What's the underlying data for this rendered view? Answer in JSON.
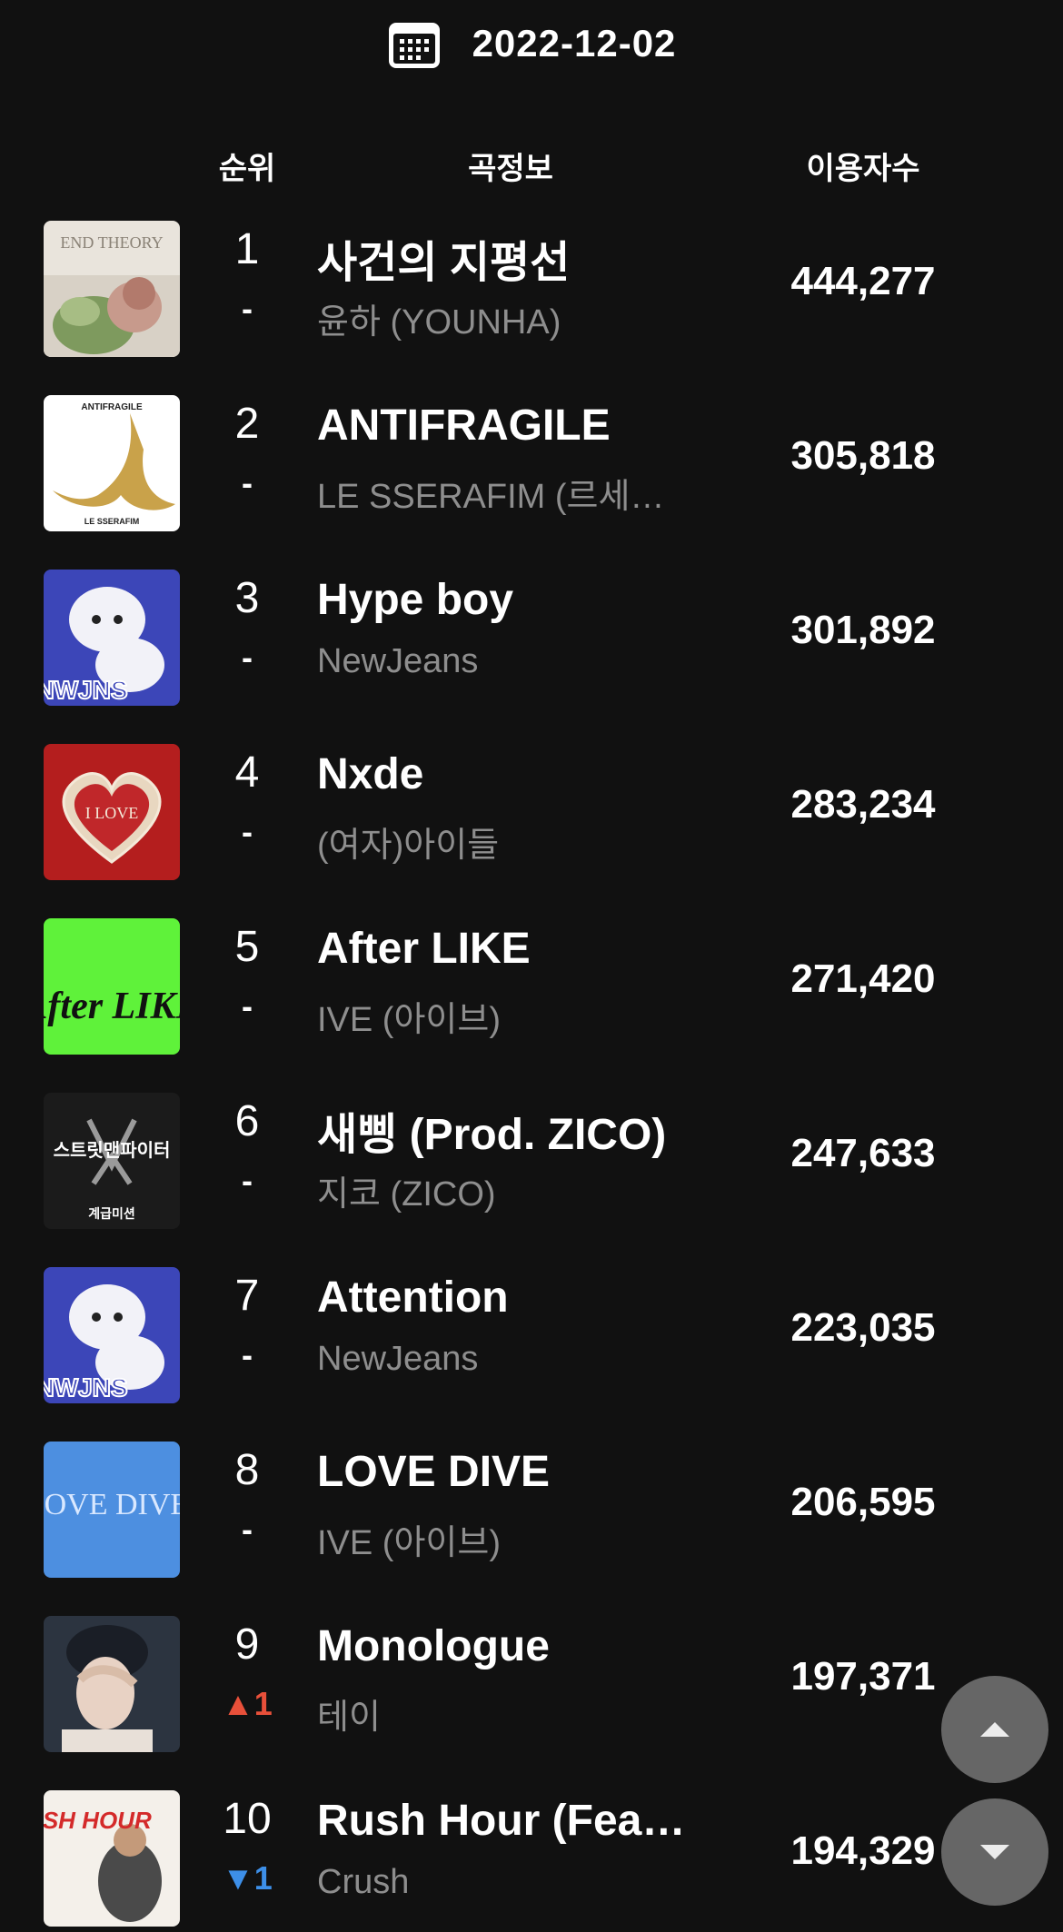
{
  "date": "2022-12-02",
  "columns": {
    "rank": "순위",
    "song_info": "곡정보",
    "listeners": "이용자수"
  },
  "songs": [
    {
      "rank": "1",
      "change": "-",
      "change_dir": "none",
      "title": "사건의 지평선",
      "artist": "윤하 (YOUNHA)",
      "listeners": "444,277",
      "cover_text": "END THEORY"
    },
    {
      "rank": "2",
      "change": "-",
      "change_dir": "none",
      "title": "ANTIFRAGILE",
      "artist": "LE SSERAFIM (르세라핌)",
      "listeners": "305,818",
      "cover_text": "ANTIFRAGILE",
      "cover_text2": "LE SSERAFIM"
    },
    {
      "rank": "3",
      "change": "-",
      "change_dir": "none",
      "title": "Hype boy",
      "artist": "NewJeans",
      "listeners": "301,892",
      "cover_text": "NWJNS"
    },
    {
      "rank": "4",
      "change": "-",
      "change_dir": "none",
      "title": "Nxde",
      "artist": "(여자)아이들",
      "listeners": "283,234",
      "cover_text": "I LOVE"
    },
    {
      "rank": "5",
      "change": "-",
      "change_dir": "none",
      "title": "After LIKE",
      "artist": "IVE (아이브)",
      "listeners": "271,420",
      "cover_text": "After LIKE"
    },
    {
      "rank": "6",
      "change": "-",
      "change_dir": "none",
      "title": "새삥 (Prod. ZICO)",
      "artist": "지코 (ZICO)",
      "listeners": "247,633",
      "cover_text": "스트릿맨파이터",
      "cover_text2": "계급미션"
    },
    {
      "rank": "7",
      "change": "-",
      "change_dir": "none",
      "title": "Attention",
      "artist": "NewJeans",
      "listeners": "223,035",
      "cover_text": "NWJNS"
    },
    {
      "rank": "8",
      "change": "-",
      "change_dir": "none",
      "title": "LOVE DIVE",
      "artist": "IVE (아이브)",
      "listeners": "206,595",
      "cover_text": "LOVE DIVE"
    },
    {
      "rank": "9",
      "change": "▲1",
      "change_dir": "up",
      "title": "Monologue",
      "artist": "테이",
      "listeners": "197,371",
      "cover_text": ""
    },
    {
      "rank": "10",
      "change": "▼1",
      "change_dir": "down",
      "title": "Rush Hour (Feat. j-hope of BTS)",
      "artist": "Crush",
      "listeners": "194,329",
      "cover_text": "RUSH HOUR"
    }
  ],
  "colors": {
    "background": "#111111",
    "up": "#e8503a",
    "down": "#3d8fe8",
    "artist": "#8e8e8e",
    "fab": "#6e6e6e"
  },
  "icons": {
    "date": "calendar-icon",
    "scroll_up": "caret-up-icon",
    "scroll_down": "caret-down-icon"
  }
}
